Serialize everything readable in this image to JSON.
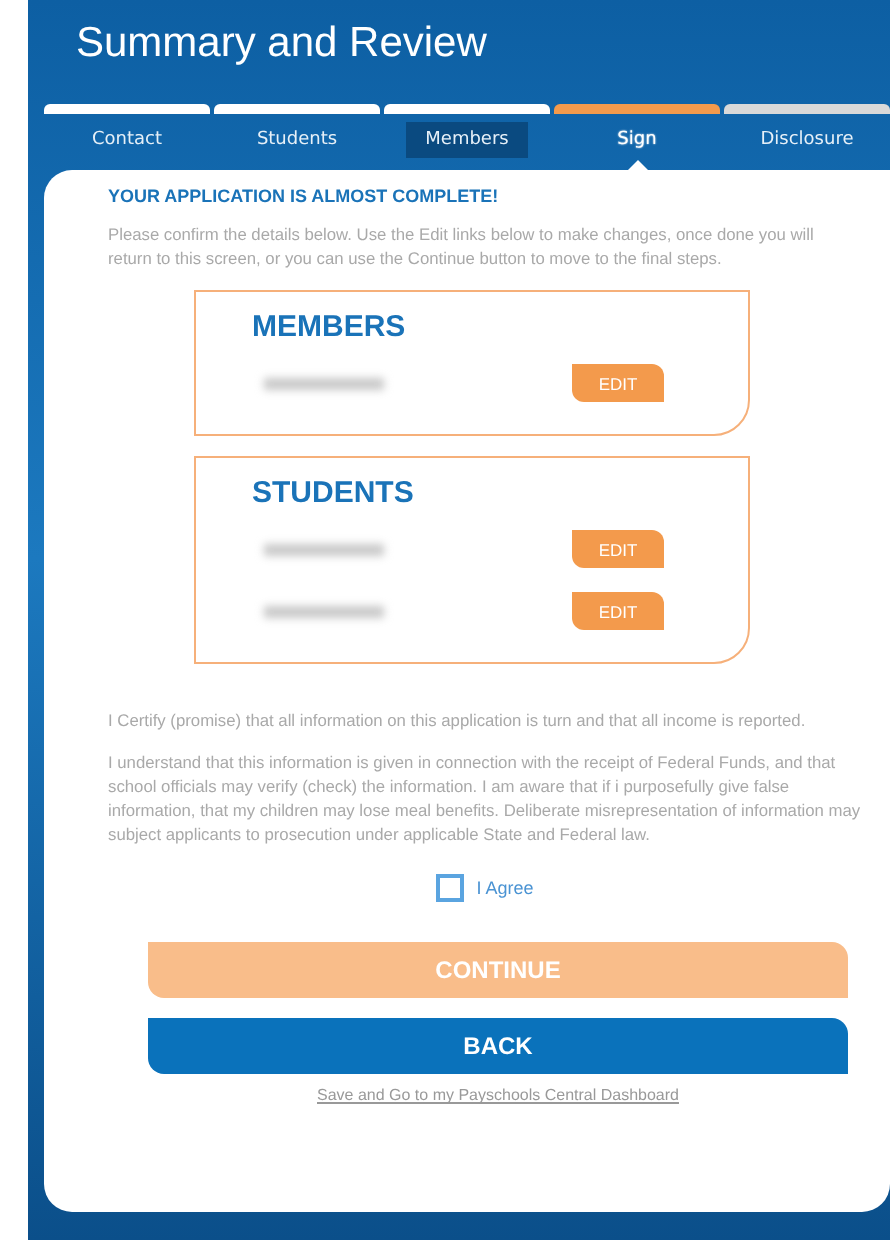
{
  "header": {
    "title": "Summary and Review"
  },
  "steps": [
    {
      "label": "Contact",
      "completed": true,
      "highlighted": false,
      "selected": false
    },
    {
      "label": "Students",
      "completed": true,
      "highlighted": false,
      "selected": false
    },
    {
      "label": "Members",
      "completed": true,
      "highlighted": true,
      "selected": false
    },
    {
      "label": "Sign",
      "completed": false,
      "highlighted": false,
      "selected": true
    },
    {
      "label": "Disclosure",
      "completed": false,
      "highlighted": false,
      "selected": false
    }
  ],
  "panel": {
    "heading": "YOUR APPLICATION IS ALMOST COMPLETE!",
    "intro": "Please confirm the details below. Use the Edit links below to make changes, once done you will return to this screen, or you can use the Continue button to move to the final steps.",
    "sections": [
      {
        "title": "MEMBERS",
        "rows": [
          {
            "kind": "redacted",
            "edit": "EDIT"
          }
        ]
      },
      {
        "title": "STUDENTS",
        "rows": [
          {
            "kind": "redacted",
            "edit": "EDIT"
          },
          {
            "kind": "redacted",
            "edit": "EDIT"
          }
        ]
      }
    ],
    "certify": "I Certify (promise) that all information on this application is turn and that all income is reported.",
    "statement": "I understand that this information is given in connection with the receipt of Federal Funds, and that school officials may verify (check) the information. I am aware that if i purposefully give false information, that my children may lose meal benefits. Deliberate misrepresentation of information may subject applicants to prosecution under applicable State and Federal law.",
    "agree": {
      "label": "I Agree",
      "checked": false
    },
    "continue": {
      "label": "CONTINUE",
      "disabled": true
    },
    "back": {
      "label": "BACK"
    },
    "dashboard_link": "Save and Go to my Payschools Central Dashboard"
  }
}
